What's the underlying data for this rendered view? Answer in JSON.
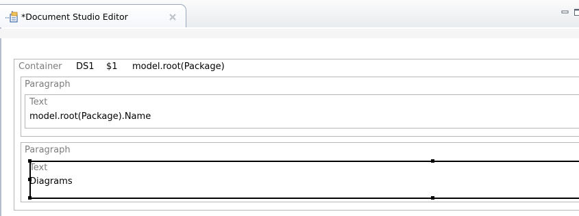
{
  "tab": {
    "title": "*Document Studio Editor",
    "icon": "document-studio-icon",
    "close_icon": "close-icon"
  },
  "window_controls": {
    "minimize_icon": "minimize-icon",
    "maximize_icon": "maximize-icon"
  },
  "container": {
    "kind": "Container",
    "name": "DS1",
    "var": "$1",
    "expr": "model.root(Package)"
  },
  "paragraphs": [
    {
      "kind": "Paragraph",
      "text": {
        "kind": "Text",
        "value": "model.root(Package).Name"
      }
    },
    {
      "kind": "Paragraph",
      "text": {
        "kind": "Text",
        "value": "Diagrams"
      },
      "selected": true
    }
  ],
  "colors": {
    "label_gray": "#7c7c7c",
    "border_gray": "#b6b6b6",
    "selection": "#000000"
  }
}
